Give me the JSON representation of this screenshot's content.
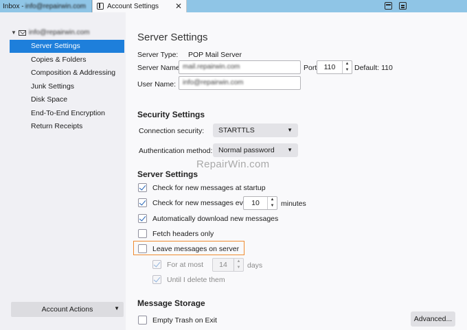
{
  "tabs": {
    "inbox_label": "Inbox -",
    "inbox_account": "info@repairwin.com",
    "account_settings_label": "Account Settings",
    "close_glyph": "✕"
  },
  "sidebar": {
    "account_email": "info@repairwin.com",
    "items": [
      {
        "label": "Server Settings",
        "selected": true
      },
      {
        "label": "Copies & Folders"
      },
      {
        "label": "Composition & Addressing"
      },
      {
        "label": "Junk Settings"
      },
      {
        "label": "Disk Space"
      },
      {
        "label": "End-To-End Encryption"
      },
      {
        "label": "Return Receipts"
      }
    ],
    "account_actions_label": "Account Actions"
  },
  "main": {
    "title": "Server Settings",
    "server_type_label": "Server Type:",
    "server_type_value": "POP Mail Server",
    "server_name_label": "Server Name:",
    "server_name_value": "mail.repairwin.com",
    "port_label": "Port:",
    "port_value": "110",
    "default_label": "Default: 110",
    "user_name_label": "User Name:",
    "user_name_value": "info@repairwin.com",
    "security": {
      "title": "Security Settings",
      "connection_label": "Connection security:",
      "connection_value": "STARTTLS",
      "auth_label": "Authentication method:",
      "auth_value": "Normal password"
    },
    "server_settings": {
      "title": "Server Settings",
      "check_startup": {
        "label": "Check for new messages at startup",
        "checked": true
      },
      "check_every": {
        "label": "Check for new messages every",
        "checked": true,
        "value": "10",
        "unit": "minutes"
      },
      "auto_download": {
        "label": "Automatically download new messages",
        "checked": true
      },
      "fetch_headers": {
        "label": "Fetch headers only",
        "checked": false
      },
      "leave_on_server": {
        "label": "Leave messages on server",
        "checked": false
      },
      "for_at_most": {
        "label": "For at most",
        "checked": true,
        "value": "14",
        "unit": "days",
        "disabled": true
      },
      "until_delete": {
        "label": "Until I delete them",
        "checked": true,
        "disabled": true
      }
    },
    "storage": {
      "title": "Message Storage",
      "empty_trash": {
        "label": "Empty Trash on Exit",
        "checked": false
      },
      "advanced_label": "Advanced..."
    },
    "watermark": "RepairWin.com"
  },
  "colors": {
    "accent": "#1e7fdb",
    "highlight": "#ef8a2f",
    "tabbar": "#8fc5e6"
  }
}
